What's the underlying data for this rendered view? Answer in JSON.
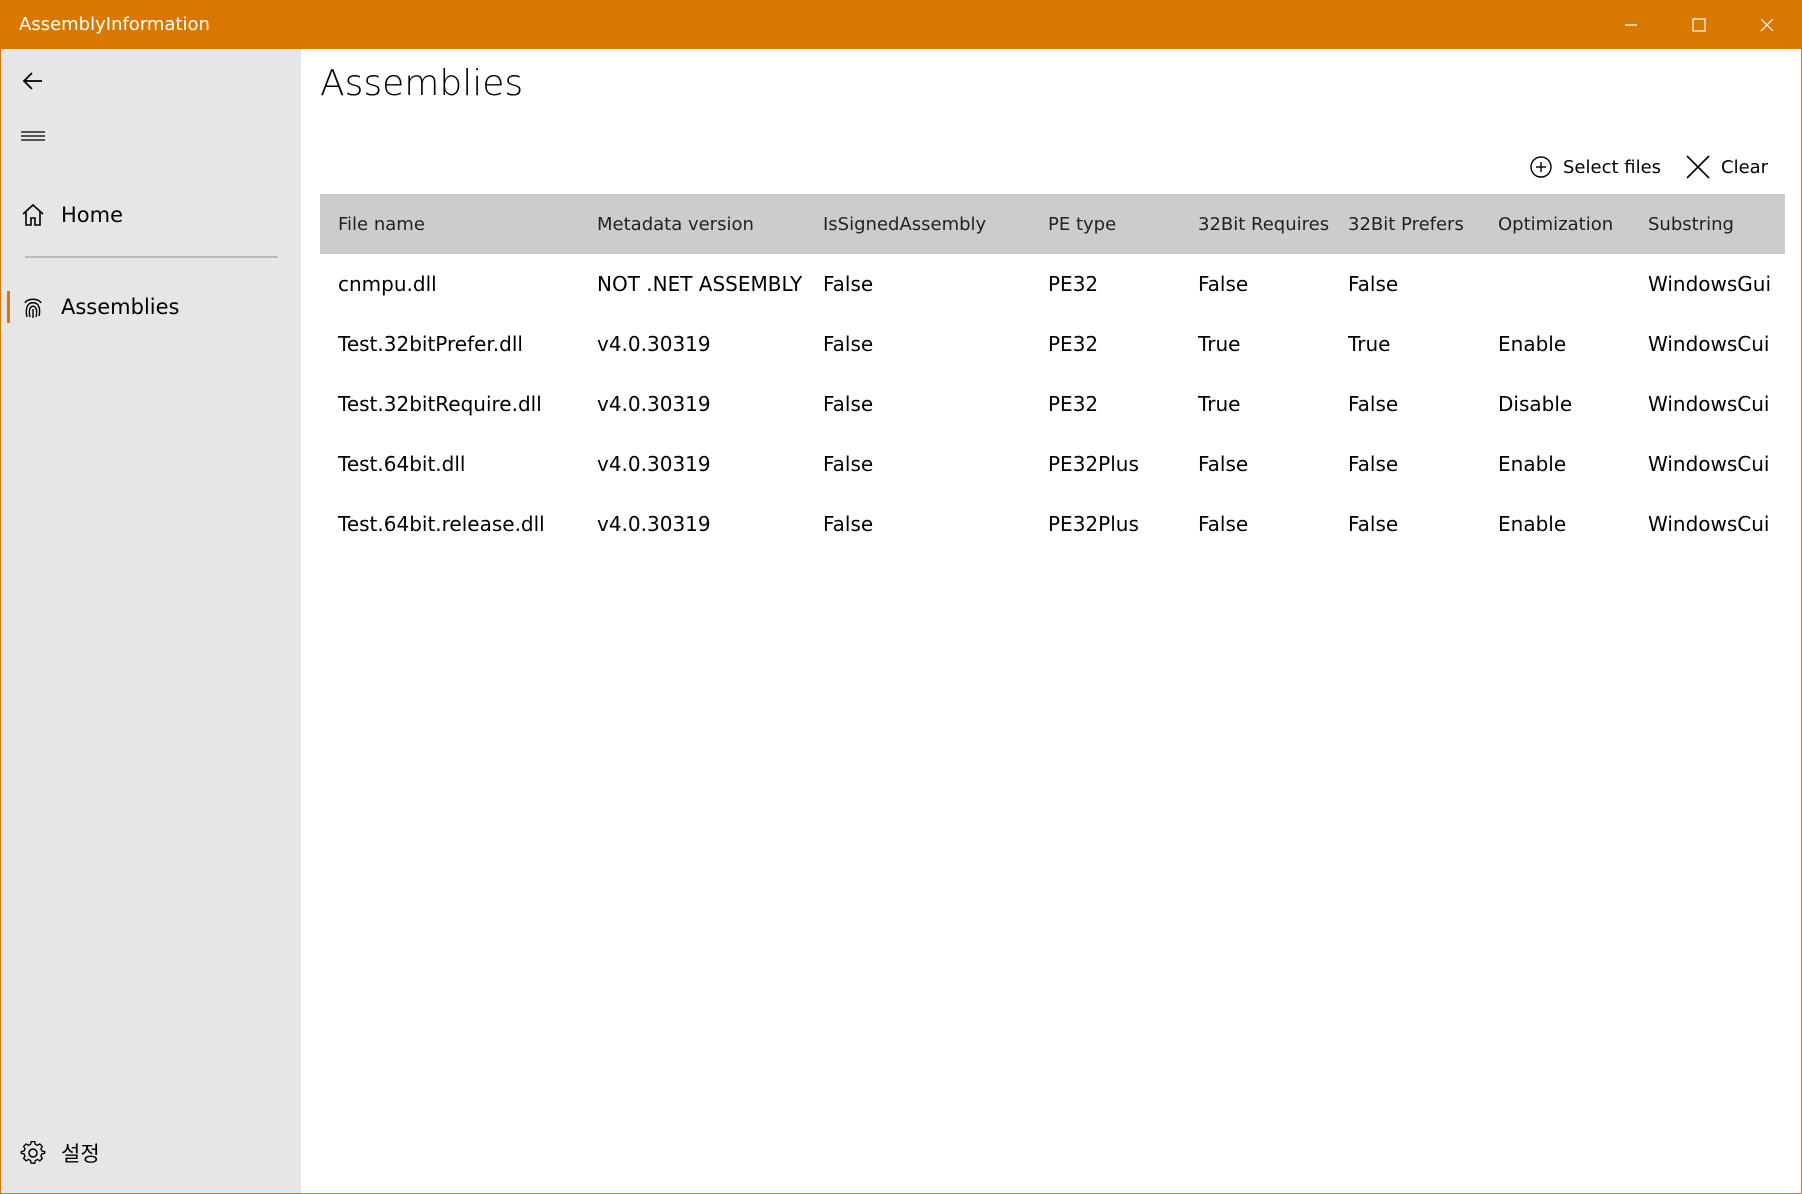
{
  "window": {
    "title": "AssemblyInformation",
    "accent_color": "#d97800",
    "controls": [
      "minimize-icon",
      "maximize-icon",
      "close-icon"
    ]
  },
  "sidebar": {
    "back_icon": "back-arrow-icon",
    "menu_icon": "hamburger-icon",
    "items": [
      {
        "label": "Home",
        "icon": "home-icon",
        "selected": false
      },
      {
        "label": "Assemblies",
        "icon": "fingerprint-icon",
        "selected": true
      }
    ],
    "settings": {
      "label": "설정",
      "icon": "gear-icon"
    }
  },
  "main": {
    "title": "Assemblies",
    "commands": [
      {
        "label": "Select files",
        "icon": "add-circle-icon"
      },
      {
        "label": "Clear",
        "icon": "close-icon"
      }
    ],
    "table": {
      "columns": [
        "File name",
        "Metadata version",
        "IsSignedAssembly",
        "PE type",
        "32Bit Requires",
        "32Bit Prefers",
        "Optimization",
        "Substring"
      ],
      "rows": [
        [
          "cnmpu.dll",
          "NOT .NET ASSEMBLY",
          "False",
          "PE32",
          "False",
          "False",
          "",
          "WindowsGui"
        ],
        [
          "Test.32bitPrefer.dll",
          "v4.0.30319",
          "False",
          "PE32",
          "True",
          "True",
          "Enable",
          "WindowsCui"
        ],
        [
          "Test.32bitRequire.dll",
          "v4.0.30319",
          "False",
          "PE32",
          "True",
          "False",
          "Disable",
          "WindowsCui"
        ],
        [
          "Test.64bit.dll",
          "v4.0.30319",
          "False",
          "PE32Plus",
          "False",
          "False",
          "Enable",
          "WindowsCui"
        ],
        [
          "Test.64bit.release.dll",
          "v4.0.30319",
          "False",
          "PE32Plus",
          "False",
          "False",
          "Enable",
          "WindowsCui"
        ]
      ]
    }
  }
}
